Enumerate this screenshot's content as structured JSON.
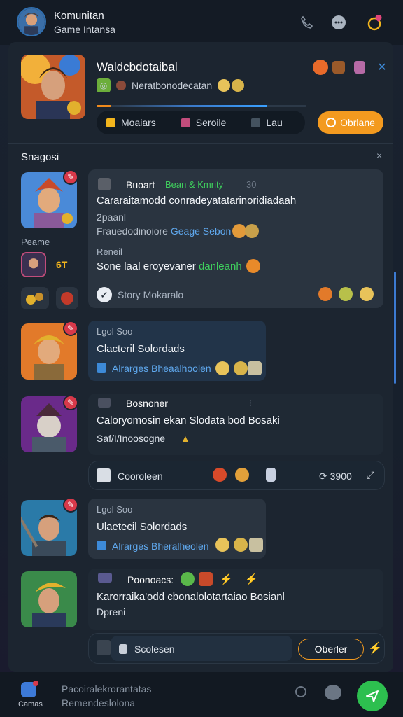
{
  "header": {
    "title": "Komunitan",
    "subtitle": "Game Intansa",
    "icons": [
      "phone-icon",
      "chat-icon",
      "heart-ring-icon"
    ]
  },
  "profile": {
    "name": "Waldcbdotaibal",
    "subtitle": "Neratbonodecatan",
    "progress_fraction": 0.07,
    "tabs": [
      {
        "label": "Moaiars",
        "color": "#f2b51d"
      },
      {
        "label": "Seroile",
        "color": "#c24d7c"
      },
      {
        "label": "Lau",
        "color": "#44525f"
      }
    ],
    "follow_label": "Obrlane"
  },
  "section": {
    "label": "Snagosi",
    "close": "×"
  },
  "side": {
    "label": "Peame",
    "badge_text": "6T"
  },
  "messages": [
    {
      "author": "Buoart",
      "author_tag": "Bean & Kmrity",
      "time": "30",
      "text": "Cararaitamodd conradeyatatarinoridiadaah",
      "sub1": "2paanl",
      "link_prefix": "Frauedodinoiore",
      "link": "Geage Sebon",
      "sub2": "Reneil",
      "text2_prefix": "Sone laal eroyevaner",
      "text2_highlight": "danleanh",
      "reply_label": "Story Mokaralo"
    },
    {
      "meta": "Lgol Soo",
      "text": "Clacteril Solordads",
      "link": "Alrarges Bheaalhoolen"
    },
    {
      "author": "Bosnoner",
      "text": "Caloryomosin ekan Slodata bod Bosaki",
      "sub": "Saf/I/Inoosogne",
      "bar_label": "Cooroleen",
      "bar_count": "3900"
    },
    {
      "meta": "Lgol Soo",
      "text": "Ulaetecil Solordads",
      "link": "Alrarges Bheralheolen"
    },
    {
      "author": "Poonoacs:",
      "text": "Karorraika'odd cbonalolotartaiao Bosianl",
      "sub": "Dpreni"
    }
  ],
  "composer": {
    "placeholder": "Scolesen",
    "button": "Oberler"
  },
  "bottom": {
    "app_label": "Camas",
    "line1": "Pacoiralekrorantatas",
    "line2": "Remendeslolona"
  },
  "colors": {
    "accent": "#f39a1f",
    "send": "#2dbf4f",
    "link": "#5fa8ee",
    "green": "#3fcf5d",
    "badge": "#d8394a"
  }
}
